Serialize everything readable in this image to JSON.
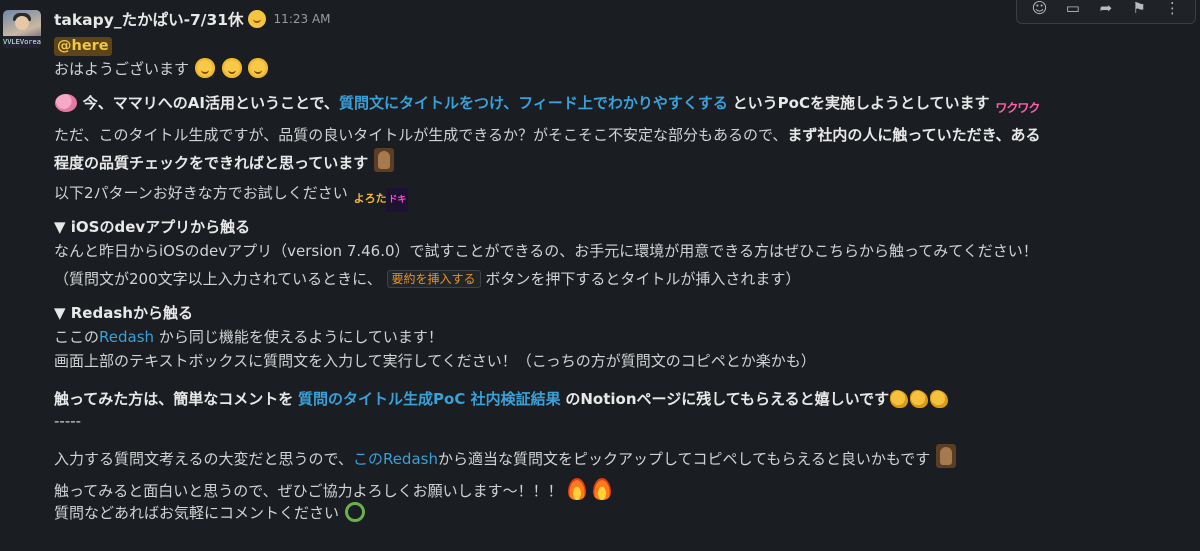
{
  "message": {
    "author": "takapy_たかぱい-7/31休",
    "timestamp": "11:23 AM",
    "avatar_sign": "VVLEVoreal"
  },
  "toolbar": {
    "icons": [
      "emoji-reaction-icon",
      "reply-in-thread-icon",
      "share-icon",
      "bookmark-icon",
      "more-actions-icon"
    ]
  },
  "body": {
    "mention": "@here",
    "greeting": "おはようございます",
    "l2_pre": "今、ママリへのAI活用ということで、",
    "l2_link": "質問文にタイトルをつけ、フィード上でわかりやすくする",
    "l2_post": "というPoCを実施しようとしています",
    "l3_pre": "ただ、このタイトル生成ですが、品質の良いタイトルが生成できるか？がそこそこ不安定な部分もあるので、",
    "l3_bold": "まず社内の人に触っていただき、ある",
    "l4_bold": "程度の品質チェックをできればと思っています",
    "l5": "以下2パターンお好きな方でお試しください",
    "sec1_title": "▼ iOSのdevアプリから触る",
    "sec1_l1": "なんと昨日からiOSのdevアプリ（version 7.46.0）で試すことができるの、お手元に環境が用意できる方はぜひこちらから触ってみてください！",
    "sec1_l2_pre": "（質問文が200文字以上入力されているときに、",
    "sec1_code": "要約を挿入する",
    "sec1_l2_post": "ボタンを押下するとタイトルが挿入されます）",
    "sec2_title": "▼ Redashから触る",
    "sec2_l1_pre": "ここの",
    "sec2_l1_link": "Redash",
    "sec2_l1_post": "から同じ機能を使えるようにしています！",
    "sec2_l2": "画面上部のテキストボックスに質問文を入力して実行してください！（こっちの方が質問文のコピペとか楽かも）",
    "l_try_pre": "触ってみた方は、簡単なコメントを",
    "l_try_link": "質問のタイトル生成PoC 社内検証結果",
    "l_try_post": "のNotionページに残してもらえると嬉しいです",
    "divider": "-----",
    "l_input_pre": "入力する質問文考えるの大変だと思うので、",
    "l_input_link": "このRedash",
    "l_input_post": "から適当な質問文をピックアップしてコピペしてもらえると良いかもです",
    "l_final1": "触ってみると面白いと思うので、ぜひご協力よろしくお願いします〜！！！",
    "l_final2": "質問などあればお気軽にコメントください"
  },
  "custom_emoji": {
    "pink": "ワクワク",
    "yoro": "よろたの",
    "doki": "ドキ"
  },
  "colors": {
    "background": "#1a1d21",
    "text": "#d1d2d3",
    "link": "#3aa0d8",
    "mention_bg": "#5c4519",
    "mention_fg": "#f2c744",
    "code_fg": "#e8912d"
  }
}
